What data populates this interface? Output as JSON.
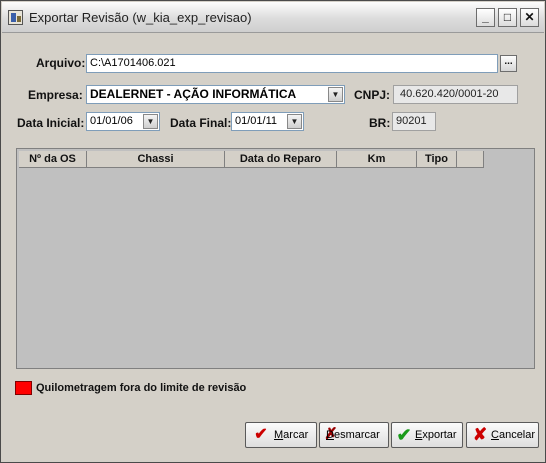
{
  "window": {
    "title": "Exportar Revisão (w_kia_exp_revisao)"
  },
  "titlebar_buttons": {
    "minimize": "_",
    "maximize": "□",
    "close": "✕"
  },
  "form": {
    "arquivo_label": "Arquivo:",
    "arquivo_value": "C:\\A1701406.021",
    "browse_label": "...",
    "empresa_label": "Empresa:",
    "empresa_value": "DEALERNET - AÇÃO INFORMÁTICA",
    "cnpj_label": "CNPJ:",
    "cnpj_value": "40.620.420/0001-20",
    "data_inicial_label": "Data Inicial:",
    "data_inicial_value": "01/01/06",
    "data_final_label": "Data Final:",
    "data_final_value": "01/01/11",
    "br_label": "BR:",
    "br_value": "90201"
  },
  "grid": {
    "columns": [
      "Nº da OS",
      "Chassi",
      "Data do Reparo",
      "Km",
      "Tipo",
      ""
    ]
  },
  "legend": {
    "text": "Quilometragem fora do limite de revisão",
    "color": "#ff0000"
  },
  "buttons": {
    "marcar": {
      "accel": "M",
      "rest": "arcar",
      "icon": "check-icon"
    },
    "desmarcar": {
      "accel": "D",
      "rest": "esmarcar",
      "icon": "uncheck-icon"
    },
    "exportar": {
      "accel": "E",
      "rest": "xportar",
      "icon": "big-check-icon"
    },
    "cancelar": {
      "accel": "C",
      "rest": "ancelar",
      "icon": "x-icon"
    }
  }
}
